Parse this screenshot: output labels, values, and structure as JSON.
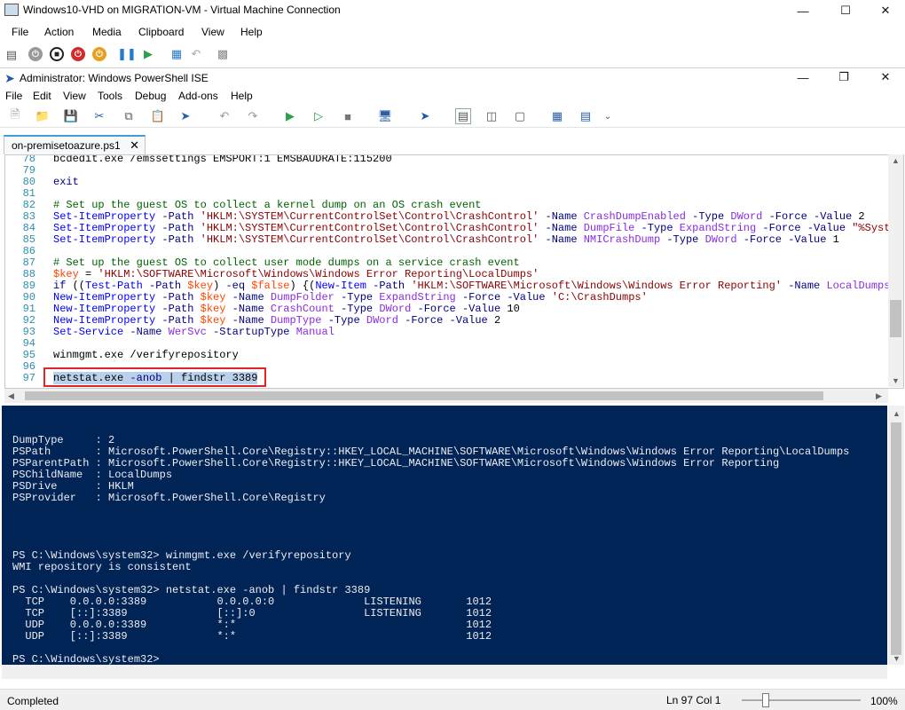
{
  "vm": {
    "title": "Windows10-VHD on MIGRATION-VM - Virtual Machine Connection",
    "menu": [
      "File",
      "Action",
      "Media",
      "Clipboard",
      "View",
      "Help"
    ]
  },
  "ise": {
    "title": "Administrator: Windows PowerShell ISE",
    "menu": [
      "File",
      "Edit",
      "View",
      "Tools",
      "Debug",
      "Add-ons",
      "Help"
    ],
    "tab": "on-premisetoazure.ps1"
  },
  "editor": {
    "lines": [
      {
        "n": "78",
        "t": "bcdedit.exe /emssettings EMSPORT:1 EMSBAUDRATE:115200"
      },
      {
        "n": "79",
        "t": ""
      },
      {
        "n": "80",
        "t": "exit"
      },
      {
        "n": "81",
        "t": ""
      },
      {
        "n": "82",
        "t": "# Set up the guest OS to collect a kernel dump on an OS crash event"
      },
      {
        "n": "83",
        "t": "Set-ItemProperty -Path 'HKLM:\\SYSTEM\\CurrentControlSet\\Control\\CrashControl' -Name CrashDumpEnabled -Type DWord -Force -Value 2"
      },
      {
        "n": "84",
        "t": "Set-ItemProperty -Path 'HKLM:\\SYSTEM\\CurrentControlSet\\Control\\CrashControl' -Name DumpFile -Type ExpandString -Force -Value \"%Syst"
      },
      {
        "n": "85",
        "t": "Set-ItemProperty -Path 'HKLM:\\SYSTEM\\CurrentControlSet\\Control\\CrashControl' -Name NMICrashDump -Type DWord -Force -Value 1"
      },
      {
        "n": "86",
        "t": ""
      },
      {
        "n": "87",
        "t": "# Set up the guest OS to collect user mode dumps on a service crash event"
      },
      {
        "n": "88",
        "t": "$key = 'HKLM:\\SOFTWARE\\Microsoft\\Windows\\Windows Error Reporting\\LocalDumps'"
      },
      {
        "n": "89",
        "t": "if ((Test-Path -Path $key) -eq $false) {(New-Item -Path 'HKLM:\\SOFTWARE\\Microsoft\\Windows\\Windows Error Reporting' -Name LocalDumps"
      },
      {
        "n": "90",
        "t": "New-ItemProperty -Path $key -Name DumpFolder -Type ExpandString -Force -Value 'C:\\CrashDumps'"
      },
      {
        "n": "91",
        "t": "New-ItemProperty -Path $key -Name CrashCount -Type DWord -Force -Value 10"
      },
      {
        "n": "92",
        "t": "New-ItemProperty -Path $key -Name DumpType -Type DWord -Force -Value 2"
      },
      {
        "n": "93",
        "t": "Set-Service -Name WerSvc -StartupType Manual"
      },
      {
        "n": "94",
        "t": ""
      },
      {
        "n": "95",
        "t": "winmgmt.exe /verifyrepository"
      },
      {
        "n": "96",
        "t": ""
      },
      {
        "n": "97",
        "t": "netstat.exe -anob | findstr 3389"
      }
    ]
  },
  "console": {
    "lines": [
      "DumpType     : 2",
      "PSPath       : Microsoft.PowerShell.Core\\Registry::HKEY_LOCAL_MACHINE\\SOFTWARE\\Microsoft\\Windows\\Windows Error Reporting\\LocalDumps",
      "PSParentPath : Microsoft.PowerShell.Core\\Registry::HKEY_LOCAL_MACHINE\\SOFTWARE\\Microsoft\\Windows\\Windows Error Reporting",
      "PSChildName  : LocalDumps",
      "PSDrive      : HKLM",
      "PSProvider   : Microsoft.PowerShell.Core\\Registry",
      "PS C:\\Windows\\system32> winmgmt.exe /verifyrepository",
      "WMI repository is consistent",
      "PS C:\\Windows\\system32> netstat.exe -anob | findstr 3389",
      "  TCP    0.0.0.0:3389           0.0.0.0:0              LISTENING       1012",
      "  TCP    [::]:3389              [::]:0                 LISTENING       1012",
      "  UDP    0.0.0.0:3389           *:*                                    1012",
      "  UDP    [::]:3389              *:*                                    1012",
      "PS C:\\Windows\\system32>"
    ]
  },
  "status": {
    "text": "Completed",
    "position": "Ln 97  Col 1",
    "zoom": "100%",
    "zoom_level": 0.18
  },
  "colors": {
    "console_bg": "#012456",
    "selection_box": "#e0252a",
    "tab_accent": "#39a0d8"
  }
}
